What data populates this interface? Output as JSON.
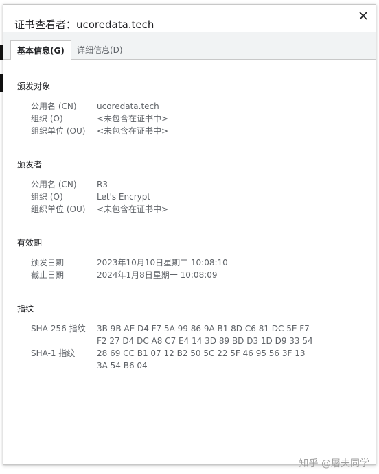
{
  "dialog": {
    "title": "证书查看者：ucoredata.tech",
    "close_glyph": "✕"
  },
  "tabs": [
    {
      "label": "基本信息(G)",
      "active": true
    },
    {
      "label": "详细信息(D)",
      "active": false
    }
  ],
  "issued_to": {
    "heading": "颁发对象",
    "rows": [
      {
        "label": "公用名 (CN)",
        "value": "ucoredata.tech"
      },
      {
        "label": "组织 (O)",
        "value": "<未包含在证书中>"
      },
      {
        "label": "组织单位 (OU)",
        "value": "<未包含在证书中>"
      }
    ]
  },
  "issued_by": {
    "heading": "颁发者",
    "rows": [
      {
        "label": "公用名 (CN)",
        "value": "R3"
      },
      {
        "label": "组织 (O)",
        "value": "Let's Encrypt"
      },
      {
        "label": "组织单位 (OU)",
        "value": "<未包含在证书中>"
      }
    ]
  },
  "validity": {
    "heading": "有效期",
    "rows": [
      {
        "label": "颁发日期",
        "value": "2023年10月10日星期二 10:08:10"
      },
      {
        "label": "截止日期",
        "value": "2024年1月8日星期一 10:08:09"
      }
    ]
  },
  "fingerprints": {
    "heading": "指纹",
    "sha256": {
      "label": "SHA-256 指纹",
      "line1": "3B 9B AE D4 F7 5A 99 86 9A B1 8D C6 81 DC 5E F7",
      "line2": "F2 27 D4 DC A8 C7 E4 14 3D 89 BD D3 1D D9 33 54"
    },
    "sha1": {
      "label": "SHA-1 指纹",
      "line1": "28 69 CC B1 07 12 B2 50 5C 22 5F 46 95 56 3F 13",
      "line2": "3A 54 B6 04"
    }
  },
  "watermark": "知乎 @屠夫同学",
  "colors": {
    "tab_bar": "#f1f3f4",
    "text_primary": "#202124",
    "text_secondary": "#5f6368"
  }
}
